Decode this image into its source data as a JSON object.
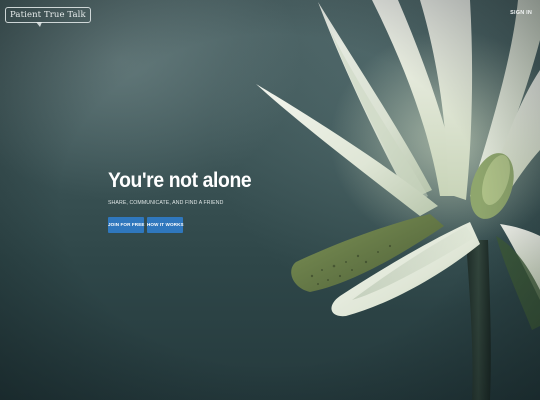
{
  "brand": {
    "logo_text": "Patient True Talk"
  },
  "header": {
    "sign_in_label": "SIGN IN"
  },
  "hero": {
    "headline": "You're not alone",
    "subline": "SHARE, COMMUNICATE, AND FIND A FRIEND",
    "join_button_label": "JOIN FOR FREE",
    "how_button_label": "HOW IT WORKS"
  },
  "colors": {
    "button_bg": "#2f77bd",
    "background_tone": "#3e5658",
    "text": "#ffffff"
  }
}
